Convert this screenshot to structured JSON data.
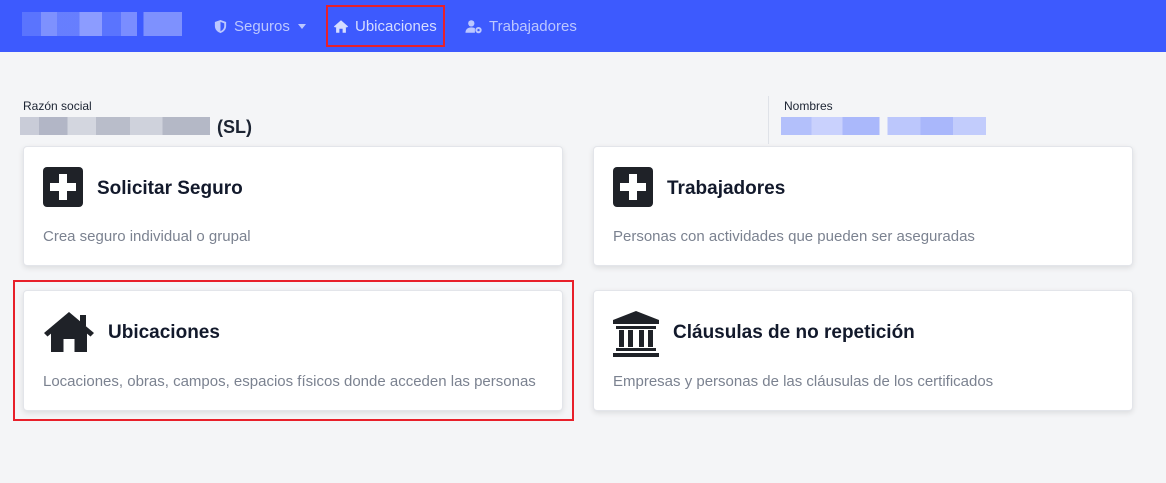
{
  "navbar": {
    "brand": "",
    "items": [
      {
        "label": "Seguros",
        "icon": "shield-icon",
        "has_dropdown": true
      },
      {
        "label": "Ubicaciones",
        "icon": "home-icon",
        "highlighted": true
      },
      {
        "label": "Trabajadores",
        "icon": "user-gear-icon"
      }
    ]
  },
  "header": {
    "razon_social_label": "Razón social",
    "razon_social_suffix": "(SL)",
    "nombres_label": "Nombres"
  },
  "cards": [
    {
      "title": "Solicitar Seguro",
      "description": "Crea seguro individual o grupal",
      "icon": "plus-square-icon"
    },
    {
      "title": "Trabajadores",
      "description": "Personas con actividades que pueden ser aseguradas",
      "icon": "plus-square-icon"
    },
    {
      "title": "Ubicaciones",
      "description": "Locaciones, obras, campos, espacios físicos donde acceden las personas",
      "icon": "home-icon",
      "highlighted": true
    },
    {
      "title": "Cláusulas de no repetición",
      "description": "Empresas y personas de las cláusulas de los certificados",
      "icon": "bank-icon"
    }
  ],
  "colors": {
    "navbar": "#3d5afe",
    "highlight": "#e8202a",
    "background": "#f4f5f7",
    "icon_dark": "#1f2228"
  }
}
